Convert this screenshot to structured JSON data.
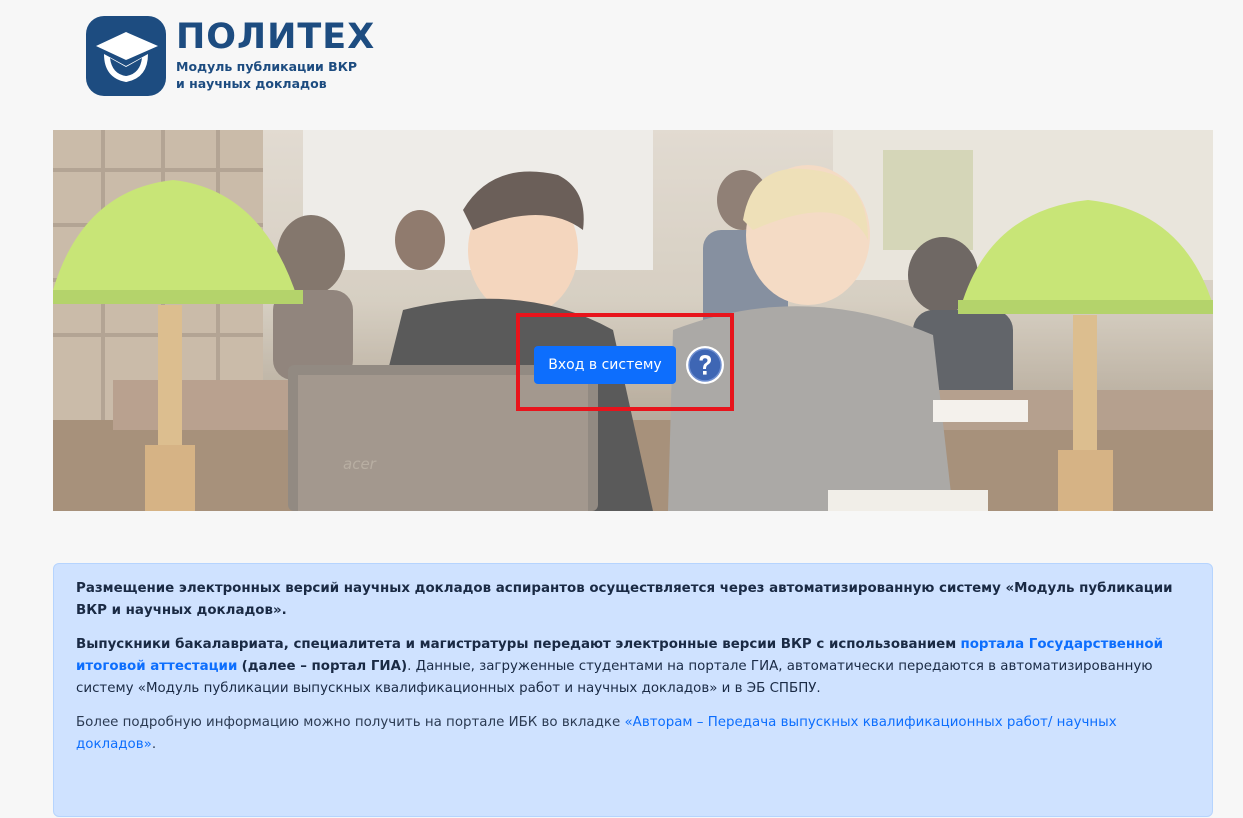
{
  "logo": {
    "title": "ПОЛИТЕХ",
    "subtitle_line1": "Модуль публикации ВКР",
    "subtitle_line2": "и научных докладов"
  },
  "hero": {
    "login_button": "Вход в систему",
    "help_icon": "question-circle-icon",
    "laptop_brand": "acer"
  },
  "info": {
    "para1": "Размещение электронных версий научных докладов аспирантов осуществляется через автоматизированную систему «Модуль публикации ВКР и научных докладов».",
    "para2_bold": "Выпускники бакалавриата, специалитета и магистратуры передают электронные версии ВКР с использованием",
    "para2_link": "портала Государственной итоговой аттестации",
    "para2_bold2": "(далее – портал ГИА)",
    "para2_rest": ". Данные, загруженные студентами на портале ГИА, автоматически передаются в автоматизированную систему «Модуль публикации выпускных квалификационных работ и научных докладов» и в ЭБ СПБПУ.",
    "para3_text": "Более подробную информацию можно получить на портале ИБК во вкладке",
    "para3_link": "«Авторам – Передача выпускных квалификационных работ/ научных докладов»",
    "para3_end": "."
  },
  "colors": {
    "brand": "#1d4c80",
    "button": "#0d6efd",
    "highlight": "#e8141c",
    "info_bg": "#cfe2ff"
  }
}
